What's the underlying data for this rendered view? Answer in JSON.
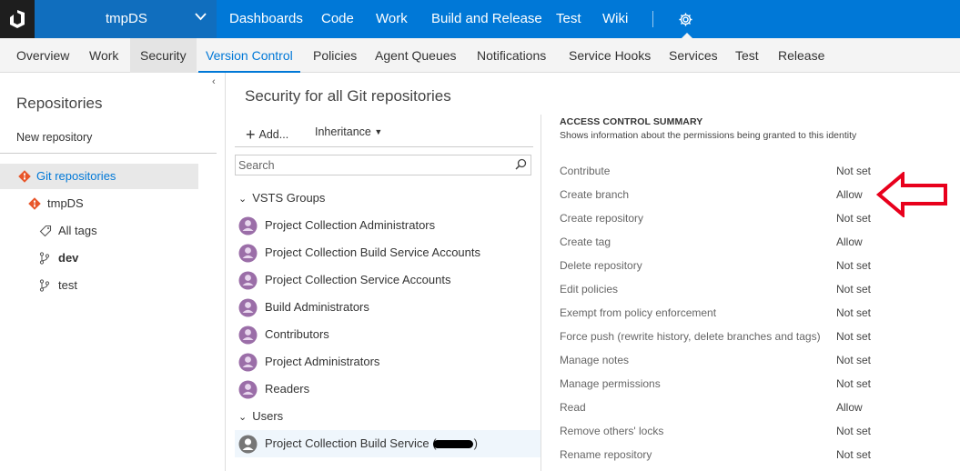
{
  "topbar": {
    "project": "tmpDS",
    "nav": [
      "Dashboards",
      "Code",
      "Work",
      "Build and Release",
      "Test",
      "Wiki"
    ],
    "colors": {
      "bar": "#0078d7",
      "project_bg": "#106ebe",
      "logo_bg": "#1e1e1e"
    }
  },
  "subnav": {
    "items": [
      "Overview",
      "Work",
      "Security",
      "Version Control",
      "Policies",
      "Agent Queues",
      "Notifications",
      "Service Hooks",
      "Services",
      "Test",
      "Release"
    ],
    "active": "Version Control"
  },
  "left": {
    "title": "Repositories",
    "new_repo": "New repository",
    "tree": {
      "git_repos": "Git repositories",
      "repo": "tmpDS",
      "all_tags": "All tags",
      "branch_dev": "dev",
      "branch_test": "test"
    }
  },
  "middle": {
    "title": "Security for all Git repositories",
    "add_label": "Add...",
    "inheritance_label": "Inheritance",
    "search_placeholder": "Search",
    "groups_header": "VSTS Groups",
    "groups": [
      "Project Collection Administrators",
      "Project Collection Build Service Accounts",
      "Project Collection Service Accounts",
      "Build Administrators",
      "Contributors",
      "Project Administrators",
      "Readers"
    ],
    "users_header": "Users",
    "user_prefix": "Project Collection Build Service (",
    "user_suffix": ")"
  },
  "summary": {
    "title": "ACCESS CONTROL SUMMARY",
    "subtitle": "Shows information about the permissions being granted to this identity",
    "permissions": [
      {
        "name": "Contribute",
        "value": "Not set"
      },
      {
        "name": "Create branch",
        "value": "Allow"
      },
      {
        "name": "Create repository",
        "value": "Not set"
      },
      {
        "name": "Create tag",
        "value": "Allow"
      },
      {
        "name": "Delete repository",
        "value": "Not set"
      },
      {
        "name": "Edit policies",
        "value": "Not set"
      },
      {
        "name": "Exempt from policy enforcement",
        "value": "Not set"
      },
      {
        "name": "Force push (rewrite history, delete branches and tags)",
        "value": "Not set"
      },
      {
        "name": "Manage notes",
        "value": "Not set"
      },
      {
        "name": "Manage permissions",
        "value": "Not set"
      },
      {
        "name": "Read",
        "value": "Allow"
      },
      {
        "name": "Remove others' locks",
        "value": "Not set"
      },
      {
        "name": "Rename repository",
        "value": "Not set"
      }
    ],
    "arrow_color": "#e8001c"
  }
}
